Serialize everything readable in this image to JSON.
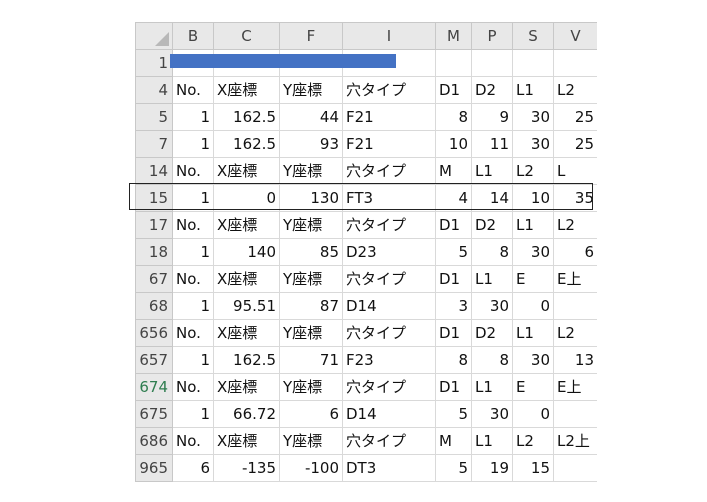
{
  "columns": [
    "B",
    "C",
    "F",
    "I",
    "M",
    "P",
    "S",
    "V"
  ],
  "accent_color": "#4472c4",
  "rows": [
    {
      "num": "1",
      "cells": [
        "",
        "",
        "",
        "",
        "",
        "",
        "",
        ""
      ]
    },
    {
      "num": "4",
      "cells": [
        "No.",
        "X座標",
        "Y座標",
        "穴タイプ",
        "D1",
        "D2",
        "L1",
        "L2"
      ]
    },
    {
      "num": "5",
      "cells": [
        "1",
        "162.5",
        "44",
        "F21",
        "8",
        "9",
        "30",
        "25"
      ]
    },
    {
      "num": "7",
      "cells": [
        "1",
        "162.5",
        "93",
        "F21",
        "10",
        "11",
        "30",
        "25"
      ]
    },
    {
      "num": "14",
      "cells": [
        "No.",
        "X座標",
        "Y座標",
        "穴タイプ",
        "M",
        "L1",
        "L2",
        "L"
      ]
    },
    {
      "num": "15",
      "cells": [
        "1",
        "0",
        "130",
        "FT3",
        "4",
        "14",
        "10",
        "35"
      ]
    },
    {
      "num": "17",
      "cells": [
        "No.",
        "X座標",
        "Y座標",
        "穴タイプ",
        "D1",
        "D2",
        "L1",
        "L2"
      ]
    },
    {
      "num": "18",
      "cells": [
        "1",
        "140",
        "85",
        "D23",
        "5",
        "8",
        "30",
        "6"
      ]
    },
    {
      "num": "67",
      "cells": [
        "No.",
        "X座標",
        "Y座標",
        "穴タイプ",
        "D1",
        "L1",
        "E",
        "E上"
      ]
    },
    {
      "num": "68",
      "cells": [
        "1",
        "95.51",
        "87",
        "D14",
        "3",
        "30",
        "0",
        ""
      ]
    },
    {
      "num": "656",
      "cells": [
        "No.",
        "X座標",
        "Y座標",
        "穴タイプ",
        "D1",
        "D2",
        "L1",
        "L2"
      ]
    },
    {
      "num": "657",
      "cells": [
        "1",
        "162.5",
        "71",
        "F23",
        "8",
        "8",
        "30",
        "13"
      ]
    },
    {
      "num": "674",
      "cells": [
        "No.",
        "X座標",
        "Y座標",
        "穴タイプ",
        "D1",
        "L1",
        "E",
        "E上"
      ]
    },
    {
      "num": "675",
      "cells": [
        "1",
        "66.72",
        "6",
        "D14",
        "5",
        "30",
        "0",
        ""
      ]
    },
    {
      "num": "686",
      "cells": [
        "No.",
        "X座標",
        "Y座標",
        "穴タイプ",
        "M",
        "L1",
        "L2",
        "L2上"
      ]
    },
    {
      "num": "965",
      "cells": [
        "6",
        "-135",
        "-100",
        "DT3",
        "5",
        "19",
        "15",
        ""
      ]
    }
  ]
}
